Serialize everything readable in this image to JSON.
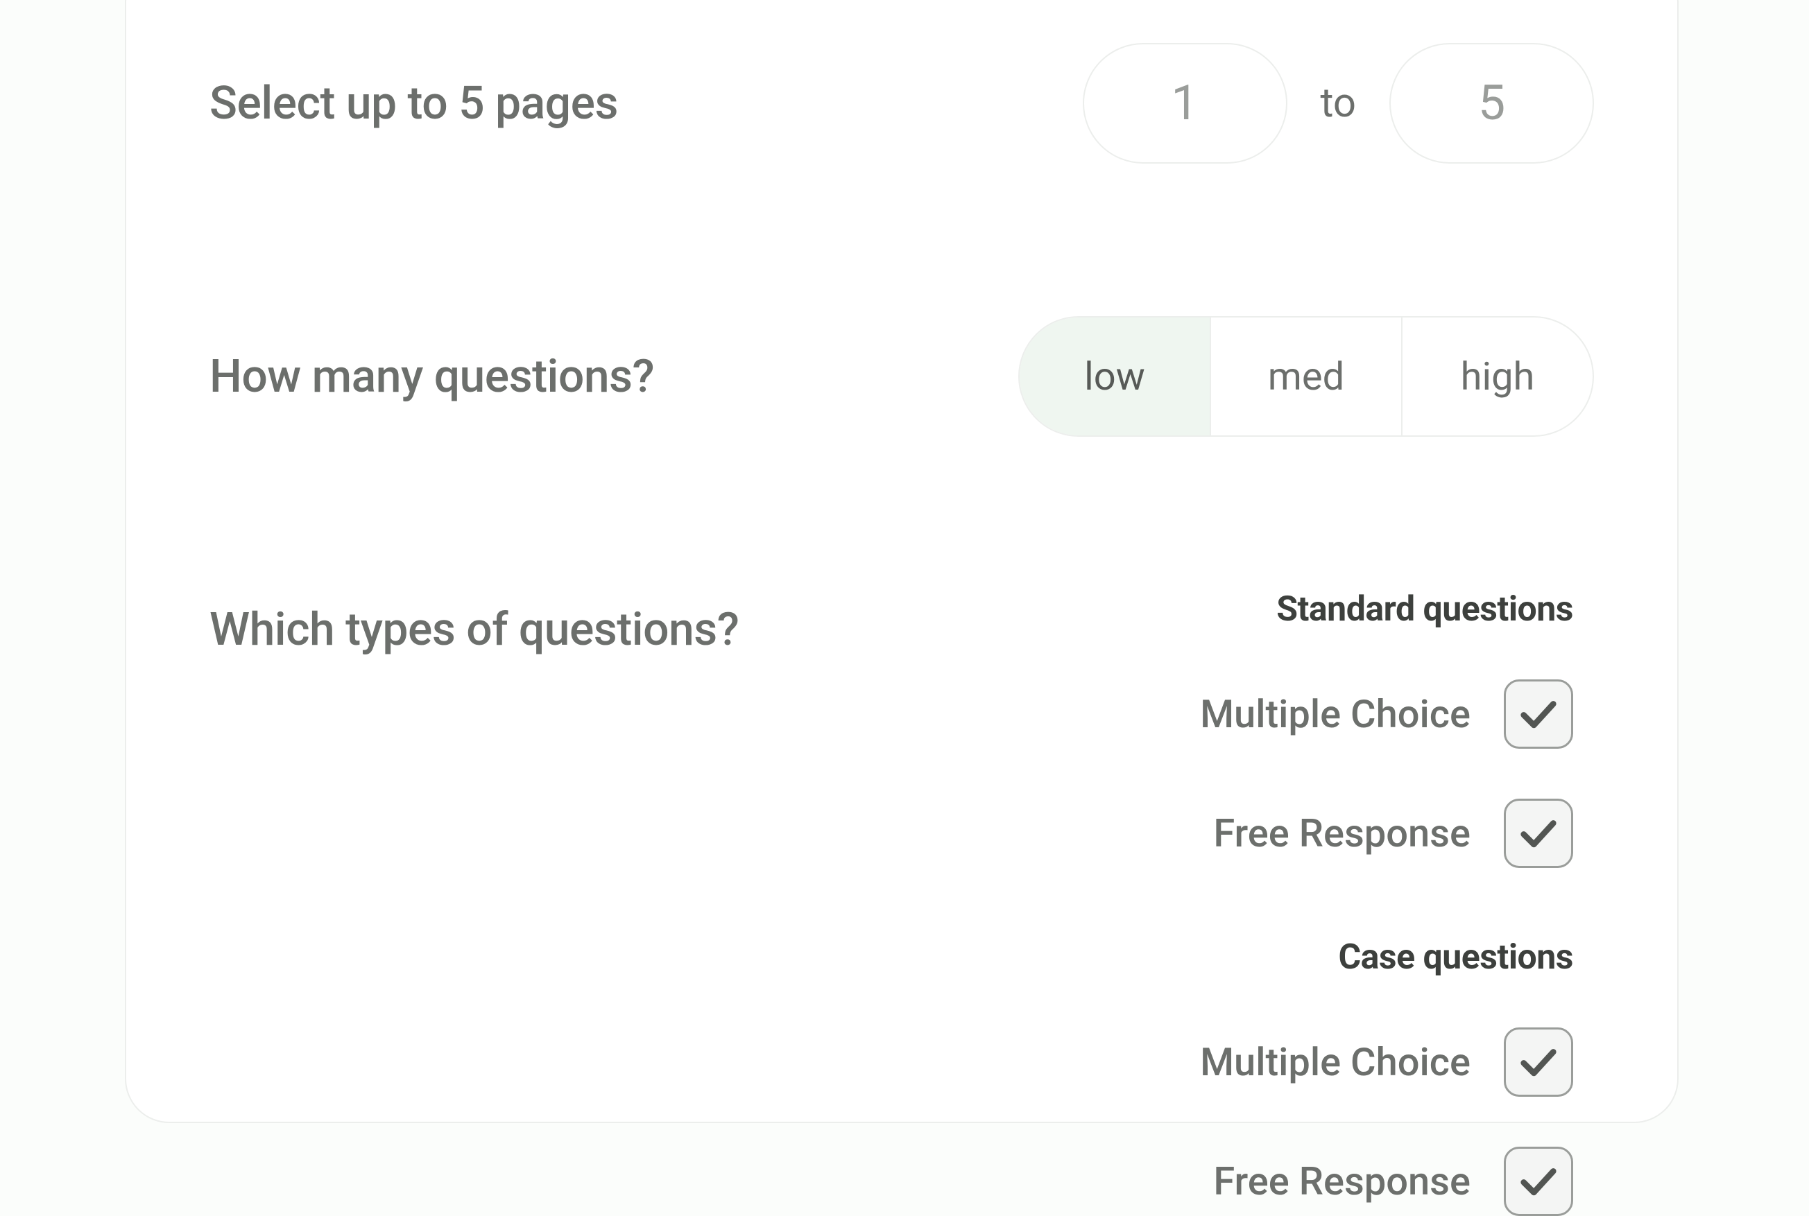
{
  "pages": {
    "label": "Select up to 5 pages",
    "from": "1",
    "separator": "to",
    "to": "5"
  },
  "count": {
    "label": "How many questions?",
    "options": [
      "low",
      "med",
      "high"
    ],
    "selected_index": 0
  },
  "types": {
    "label": "Which types of questions?",
    "groups": [
      {
        "title": "Standard questions",
        "items": [
          {
            "label": "Multiple Choice",
            "checked": true
          },
          {
            "label": "Free Response",
            "checked": true
          }
        ]
      },
      {
        "title": "Case questions",
        "items": [
          {
            "label": "Multiple Choice",
            "checked": true
          },
          {
            "label": "Free Response",
            "checked": true
          }
        ]
      }
    ]
  }
}
